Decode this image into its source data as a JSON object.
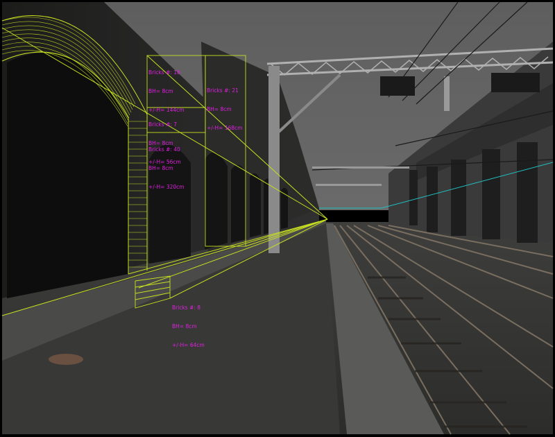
{
  "annotations": [
    {
      "id": "a1",
      "lines": [
        "Bricks #: 18",
        "BH= 8cm",
        "+/-H= 144cm"
      ]
    },
    {
      "id": "a2",
      "lines": [
        "Bricks #: 21",
        "BH= 8cm",
        "+/-H= 168cm"
      ]
    },
    {
      "id": "a3",
      "lines": [
        "Bricks #: 7",
        "BH= 8cm",
        "+/-H= 56cm"
      ]
    },
    {
      "id": "a4",
      "lines": [
        "Bricks #: 40",
        "BH= 8cm",
        "+/-H= 320cm"
      ]
    },
    {
      "id": "a5",
      "lines": [
        "Bricks #: 8",
        "BH= 8cm",
        "+/-H= 64cm"
      ]
    }
  ],
  "colors": {
    "guide_lines": "#c8e020",
    "horizon_line": "#20c0c0",
    "annotation_text": "#e020e0",
    "frame": "#000000"
  }
}
